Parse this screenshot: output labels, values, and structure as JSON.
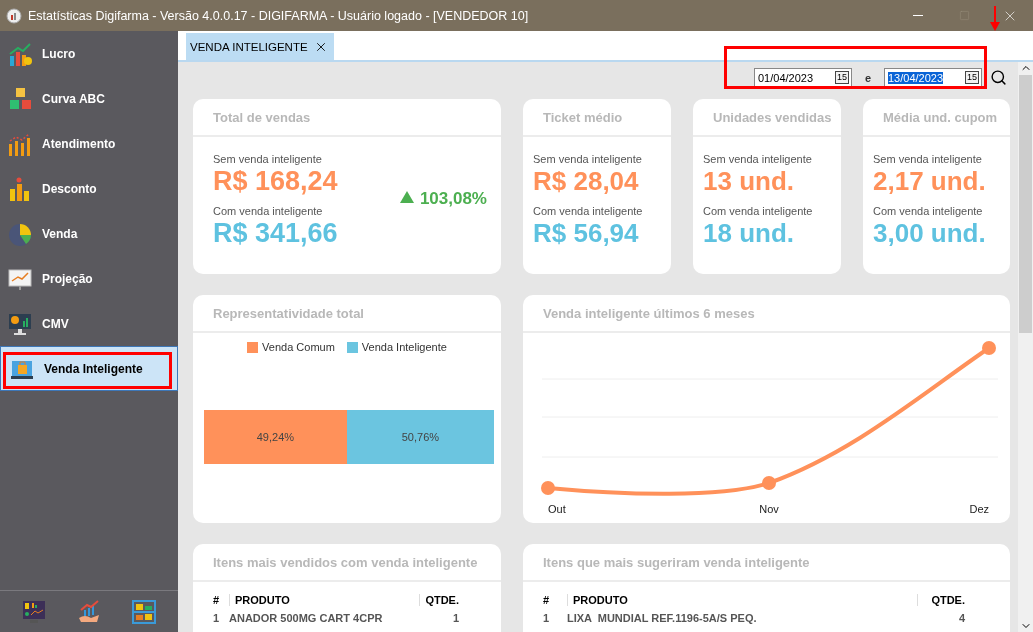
{
  "window": {
    "title": "Estatísticas Digifarma - Versão 4.0.0.17 - DIGIFARMA -  Usuário logado - [VENDEDOR 10]"
  },
  "sidebar": {
    "items": [
      {
        "label": "Lucro",
        "kind": "profit",
        "selected": false
      },
      {
        "label": "Curva ABC",
        "kind": "abc",
        "selected": false
      },
      {
        "label": "Atendimento",
        "kind": "bars",
        "selected": false
      },
      {
        "label": "Desconto",
        "kind": "discount",
        "selected": false
      },
      {
        "label": "Venda",
        "kind": "pie",
        "selected": false
      },
      {
        "label": "Projeção",
        "kind": "board",
        "selected": false
      },
      {
        "label": "CMV",
        "kind": "monitor",
        "selected": false
      },
      {
        "label": "Venda Inteligente",
        "kind": "bag",
        "selected": true
      }
    ]
  },
  "tabs": [
    {
      "label": "VENDA INTELIGENTE",
      "selected": true
    }
  ],
  "date_filter": {
    "from": {
      "value": "01/04/2023",
      "calendar": "15",
      "text_selected": false
    },
    "separator": "e",
    "to": {
      "value": "13/04/2023",
      "calendar": "15",
      "text_selected": true
    }
  },
  "kpi_cards": [
    {
      "title": "Total de vendas",
      "without_label": "Sem venda inteligente",
      "without_value": "R$ 168,24",
      "with_label": "Com venda inteligente",
      "with_value": "R$ 341,66",
      "change": "103,08%"
    },
    {
      "title": "Ticket médio",
      "without_label": "Sem venda inteligente",
      "without_value": "R$ 28,04",
      "with_label": "Com venda inteligente",
      "with_value": "R$ 56,94"
    },
    {
      "title": "Unidades vendidas",
      "without_label": "Sem venda inteligente",
      "without_value": "13 und.",
      "with_label": "Com venda inteligente",
      "with_value": "18 und."
    },
    {
      "title": "Média und. cupom",
      "without_label": "Sem venda inteligente",
      "without_value": "2,17 und.",
      "with_label": "Com venda inteligente",
      "with_value": "3,00 und."
    }
  ],
  "share_card": {
    "title": "Representatividade total",
    "chart_data": {
      "type": "bar",
      "orientation": "horizontal",
      "stacked": true,
      "series": [
        {
          "name": "Venda Comum",
          "color": "#ff915a",
          "values": [
            49.24
          ],
          "value_labels": [
            "49,24%"
          ]
        },
        {
          "name": "Venda Inteligente",
          "color": "#6bc5e0",
          "values": [
            50.76
          ],
          "value_labels": [
            "50,76%"
          ]
        }
      ]
    }
  },
  "trend_card": {
    "title": "Venda inteligente últimos 6 meses",
    "x_labels": [
      "Out",
      "Nov",
      "Dez"
    ]
  },
  "tables": [
    {
      "title": "Itens mais vendidos com venda inteligente",
      "columns": [
        "#",
        "PRODUTO",
        "QTDE."
      ],
      "rows": [
        [
          "1",
          "ANADOR 500MG CART 4CPR",
          "1"
        ]
      ]
    },
    {
      "title": "Itens que mais sugeriram venda inteligente",
      "columns": [
        "#",
        "PRODUTO",
        "QTDE."
      ],
      "rows": [
        [
          "1",
          "LIXA  MUNDIAL REF.1196-5A/S PEQ.",
          "4"
        ]
      ]
    }
  ]
}
